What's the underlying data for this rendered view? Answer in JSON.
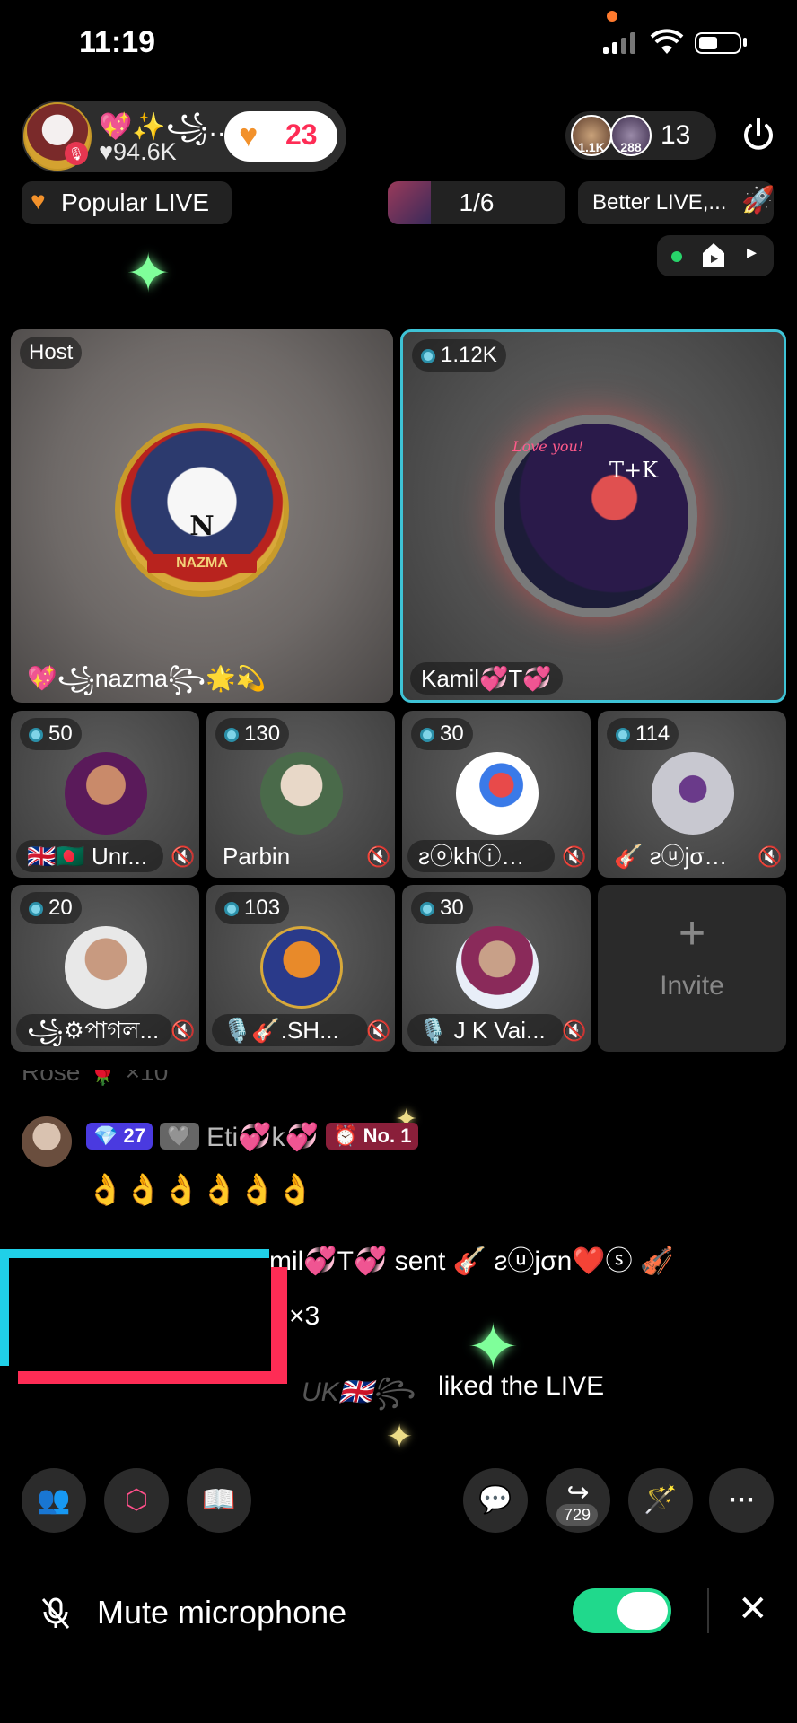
{
  "status_bar": {
    "time": "11:19"
  },
  "header": {
    "host_name": "💖✨꧁…",
    "host_likes": "♥94.6K",
    "like_count": "23",
    "viewer_count": "13",
    "viewer_avatars": [
      "1.1K",
      "288"
    ]
  },
  "tags": {
    "popular": "Popular LIVE",
    "page": "1/6",
    "better": "Better LIVE,..."
  },
  "host_tile": {
    "badge": "Host",
    "name": "💖꧁nazma꧂🌟💫",
    "avatar_text": "N",
    "avatar_label": "NAZMA"
  },
  "guest_tile": {
    "count": "1.12K",
    "name": "Kamil💞T💞",
    "avatar_text": "T+K",
    "avatar_caption": "Love you!"
  },
  "small_tiles": [
    {
      "count": "50",
      "name": "🇬🇧🇧🇩 Unr..."
    },
    {
      "count": "130",
      "name": "Parbin"
    },
    {
      "count": "30",
      "name": "ƨⓞkhⓘ…"
    },
    {
      "count": "114",
      "name": "🎸 ƨⓤjσ…"
    },
    {
      "count": "20",
      "name": "꧁⚙পাগল..."
    },
    {
      "count": "103",
      "name": "🎙️🎸.SH..."
    },
    {
      "count": "30",
      "name": "🎙️ J K Vai..."
    }
  ],
  "invite": {
    "label": "Invite",
    "plus": "+"
  },
  "chat": {
    "cut_text": "Rose 🌹 ×10",
    "msg1_level": "27",
    "msg1_rank": "No. 1",
    "msg1_user": "Eti💞k💞",
    "msg1_text": "👌👌👌👌👌👌",
    "msg2_text": "mil💞T💞 sent 🎸 ƨⓤjσn❤️ⓢ 🎻",
    "msg2_multiplier": "×3",
    "msg3_text": "liked the LIVE",
    "msg3_user": "UK🇬🇧꧂"
  },
  "toolbar": {
    "share_count": "729"
  },
  "mute_bar": {
    "label": "Mute microphone",
    "close": "✕"
  },
  "colors": {
    "accent_cyan": "#3ec3d6",
    "like_red": "#fe2c55",
    "toggle_green": "#20d98c"
  }
}
